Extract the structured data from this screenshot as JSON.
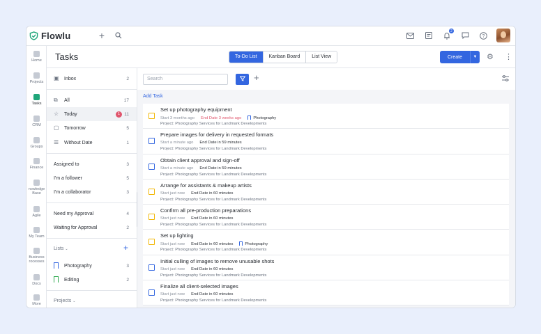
{
  "app": {
    "name": "Flowlu"
  },
  "page": {
    "title": "Tasks"
  },
  "view_tabs": [
    {
      "label": "To-Do List",
      "active": true
    },
    {
      "label": "Kanban Board",
      "active": false
    },
    {
      "label": "List View",
      "active": false
    }
  ],
  "header": {
    "create_label": "Create",
    "notification_count": "2"
  },
  "left_nav": [
    {
      "label": "Home",
      "icon": "home-icon"
    },
    {
      "label": "Projects",
      "icon": "projects-icon"
    },
    {
      "label": "Tasks",
      "icon": "tasks-icon",
      "active": true
    },
    {
      "label": "CRM",
      "icon": "crm-icon"
    },
    {
      "label": "Groups",
      "icon": "groups-icon"
    },
    {
      "label": "Finance",
      "icon": "finance-icon"
    },
    {
      "label": "nowledge Base",
      "icon": "knowledge-base-icon"
    },
    {
      "label": "Agile",
      "icon": "agile-icon"
    },
    {
      "label": "My Team",
      "icon": "team-icon"
    },
    {
      "label": "Business rocesses",
      "icon": "business-processes-icon"
    },
    {
      "label": "Docs",
      "icon": "docs-icon"
    },
    {
      "label": "More",
      "icon": "more-icon"
    }
  ],
  "sidebar": {
    "inbox": {
      "label": "Inbox",
      "count": "2"
    },
    "filters": [
      {
        "label": "All",
        "count": "17"
      },
      {
        "label": "Today",
        "count": "11",
        "badge": "1"
      },
      {
        "label": "Tomorrow",
        "count": "5"
      },
      {
        "label": "Without Date",
        "count": "1"
      }
    ],
    "roles": [
      {
        "label": "Assigned to",
        "count": "3"
      },
      {
        "label": "I'm a follower",
        "count": "5"
      },
      {
        "label": "I'm a collaborator",
        "count": "3"
      }
    ],
    "approval": [
      {
        "label": "Need my Approval",
        "count": "4"
      },
      {
        "label": "Waiting for Approval",
        "count": "2"
      }
    ],
    "lists_label": "Lists",
    "lists": [
      {
        "label": "Photography",
        "count": "3"
      },
      {
        "label": "Editing",
        "count": "2"
      }
    ],
    "projects_label": "Projects"
  },
  "toolbar": {
    "search_placeholder": "Search",
    "add_task_label": "Add Task"
  },
  "tasks": [
    {
      "name": "Set up photography equipment",
      "start": "Start 3 months ago",
      "end": "End Date 3 weeks ago",
      "end_overdue": true,
      "tag": "Photography",
      "project": "Project: Photography Services for Landmark Developments",
      "check_color": "yellow"
    },
    {
      "name": "Prepare images for delivery in requested formats",
      "start": "Start a minute ago",
      "end": "End Date in 59 minutes",
      "end_overdue": false,
      "tag": "",
      "project": "Project: Photography Services for Landmark Developments",
      "check_color": "blue"
    },
    {
      "name": "Obtain client approval and sign-off",
      "start": "Start a minute ago",
      "end": "End Date in 59 minutes",
      "end_overdue": false,
      "tag": "",
      "project": "Project: Photography Services for Landmark Developments",
      "check_color": "blue"
    },
    {
      "name": "Arrange for assistants & makeup artists",
      "start": "Start just now",
      "end": "End Date in 60 minutes",
      "end_overdue": false,
      "tag": "",
      "project": "Project: Photography Services for Landmark Developments",
      "check_color": "yellow"
    },
    {
      "name": "Confirm all pre-production preparations",
      "start": "Start just now",
      "end": "End Date in 60 minutes",
      "end_overdue": false,
      "tag": "",
      "project": "Project: Photography Services for Landmark Developments",
      "check_color": "yellow"
    },
    {
      "name": "Set up lighting",
      "start": "Start just now",
      "end": "End Date in 60 minutes",
      "end_overdue": false,
      "tag": "Photography",
      "project": "Project: Photography Services for Landmark Developments",
      "check_color": "yellow"
    },
    {
      "name": "Initial culling of images to remove unusable shots",
      "start": "Start just now",
      "end": "End Date in 60 minutes",
      "end_overdue": false,
      "tag": "",
      "project": "Project: Photography Services for Landmark Developments",
      "check_color": "blue"
    },
    {
      "name": "Finalize all client-selected images",
      "start": "Start just now",
      "end": "End Date in 60 minutes",
      "end_overdue": false,
      "tag": "",
      "project": "Project: Photography Services for Landmark Developments",
      "check_color": "blue"
    }
  ],
  "colors": {
    "accent": "#3366e0",
    "overdue": "#e0566d",
    "pending": "#f2b705",
    "brand_green": "#1fa67a"
  }
}
